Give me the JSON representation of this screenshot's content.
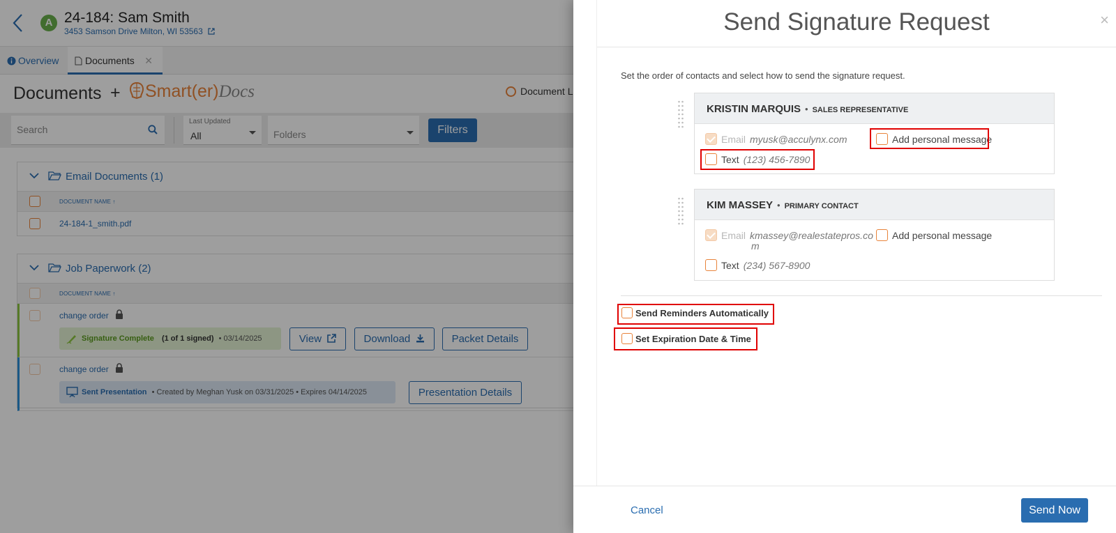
{
  "job": {
    "title": "24-184: Sam Smith",
    "address": "3453 Samson Drive Milton, WI 53563",
    "avatar_letter": "A"
  },
  "tabs": [
    {
      "label": "Overview",
      "icon": "info-icon"
    },
    {
      "label": "Documents",
      "icon": "document-icon"
    }
  ],
  "docs_header": {
    "title": "Documents",
    "plus": "+",
    "logo_text": "Smart(er)",
    "logo_italic": "Docs",
    "library_label": "Document Li"
  },
  "filters": {
    "search_placeholder": "Search",
    "last_updated_label": "Last Updated",
    "last_updated_value": "All",
    "folders_placeholder": "Folders",
    "filters_button": "Filters"
  },
  "groups": [
    {
      "title": "Email Documents (1)",
      "column": "DOCUMENT NAME ↑",
      "docs": [
        {
          "name": "24-184-1_smith.pdf"
        }
      ]
    },
    {
      "title": "Job Paperwork (2)",
      "column": "DOCUMENT NAME ↑",
      "docs": [
        {
          "name": "change order",
          "status": "Signature Complete",
          "detail_bold": "(1 of 1 signed)",
          "detail": "• 03/14/2025",
          "buttons": [
            "View",
            "Download",
            "Packet Details"
          ]
        },
        {
          "name": "change order",
          "status": "Sent Presentation",
          "detail": "• Created by Meghan Yusk on 03/31/2025 • Expires 04/14/2025",
          "buttons": [
            "Presentation Details"
          ]
        }
      ]
    }
  ],
  "modal": {
    "title": "Send Signature Request",
    "close": "×",
    "instructions": "Set the order of contacts and select how to send the signature request.",
    "contacts": [
      {
        "name": "KRISTIN MARQUIS",
        "dot": "•",
        "role": "SALES REPRESENTATIVE",
        "email_label": "Email",
        "email": "myusk@acculynx.com",
        "text_label": "Text",
        "phone": "(123) 456-7890",
        "message_label": "Add personal message"
      },
      {
        "name": "KIM MASSEY",
        "dot": "•",
        "role": "PRIMARY CONTACT",
        "email_label": "Email",
        "email_line1": "kmassey@realestatepros.co",
        "email_line2": "m",
        "text_label": "Text",
        "phone": "(234) 567-8900",
        "message_label": "Add personal message"
      }
    ],
    "send_reminders": "Send Reminders Automatically",
    "set_expiration": "Set Expiration Date & Time",
    "cancel": "Cancel",
    "send_now": "Send Now"
  },
  "colors": {
    "accent": "#2a6db0",
    "checkbox": "#e8833a",
    "highlight": "#e00000",
    "complete": "#8cc63f"
  }
}
